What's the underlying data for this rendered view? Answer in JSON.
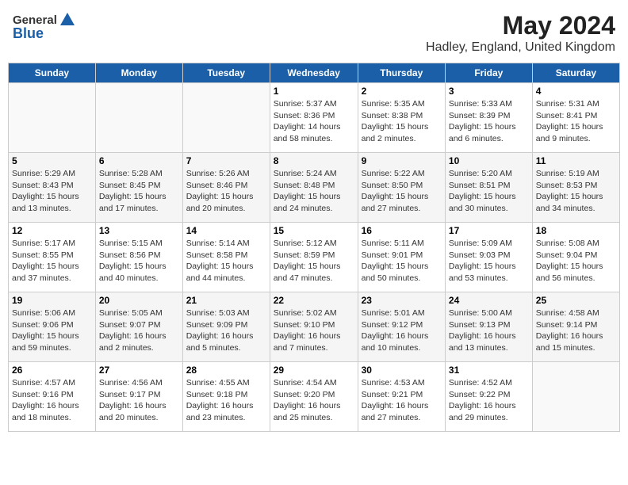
{
  "header": {
    "logo_general": "General",
    "logo_blue": "Blue",
    "month_year": "May 2024",
    "location": "Hadley, England, United Kingdom"
  },
  "weekdays": [
    "Sunday",
    "Monday",
    "Tuesday",
    "Wednesday",
    "Thursday",
    "Friday",
    "Saturday"
  ],
  "weeks": [
    [
      {
        "day": "",
        "info": ""
      },
      {
        "day": "",
        "info": ""
      },
      {
        "day": "",
        "info": ""
      },
      {
        "day": "1",
        "info": "Sunrise: 5:37 AM\nSunset: 8:36 PM\nDaylight: 14 hours\nand 58 minutes."
      },
      {
        "day": "2",
        "info": "Sunrise: 5:35 AM\nSunset: 8:38 PM\nDaylight: 15 hours\nand 2 minutes."
      },
      {
        "day": "3",
        "info": "Sunrise: 5:33 AM\nSunset: 8:39 PM\nDaylight: 15 hours\nand 6 minutes."
      },
      {
        "day": "4",
        "info": "Sunrise: 5:31 AM\nSunset: 8:41 PM\nDaylight: 15 hours\nand 9 minutes."
      }
    ],
    [
      {
        "day": "5",
        "info": "Sunrise: 5:29 AM\nSunset: 8:43 PM\nDaylight: 15 hours\nand 13 minutes."
      },
      {
        "day": "6",
        "info": "Sunrise: 5:28 AM\nSunset: 8:45 PM\nDaylight: 15 hours\nand 17 minutes."
      },
      {
        "day": "7",
        "info": "Sunrise: 5:26 AM\nSunset: 8:46 PM\nDaylight: 15 hours\nand 20 minutes."
      },
      {
        "day": "8",
        "info": "Sunrise: 5:24 AM\nSunset: 8:48 PM\nDaylight: 15 hours\nand 24 minutes."
      },
      {
        "day": "9",
        "info": "Sunrise: 5:22 AM\nSunset: 8:50 PM\nDaylight: 15 hours\nand 27 minutes."
      },
      {
        "day": "10",
        "info": "Sunrise: 5:20 AM\nSunset: 8:51 PM\nDaylight: 15 hours\nand 30 minutes."
      },
      {
        "day": "11",
        "info": "Sunrise: 5:19 AM\nSunset: 8:53 PM\nDaylight: 15 hours\nand 34 minutes."
      }
    ],
    [
      {
        "day": "12",
        "info": "Sunrise: 5:17 AM\nSunset: 8:55 PM\nDaylight: 15 hours\nand 37 minutes."
      },
      {
        "day": "13",
        "info": "Sunrise: 5:15 AM\nSunset: 8:56 PM\nDaylight: 15 hours\nand 40 minutes."
      },
      {
        "day": "14",
        "info": "Sunrise: 5:14 AM\nSunset: 8:58 PM\nDaylight: 15 hours\nand 44 minutes."
      },
      {
        "day": "15",
        "info": "Sunrise: 5:12 AM\nSunset: 8:59 PM\nDaylight: 15 hours\nand 47 minutes."
      },
      {
        "day": "16",
        "info": "Sunrise: 5:11 AM\nSunset: 9:01 PM\nDaylight: 15 hours\nand 50 minutes."
      },
      {
        "day": "17",
        "info": "Sunrise: 5:09 AM\nSunset: 9:03 PM\nDaylight: 15 hours\nand 53 minutes."
      },
      {
        "day": "18",
        "info": "Sunrise: 5:08 AM\nSunset: 9:04 PM\nDaylight: 15 hours\nand 56 minutes."
      }
    ],
    [
      {
        "day": "19",
        "info": "Sunrise: 5:06 AM\nSunset: 9:06 PM\nDaylight: 15 hours\nand 59 minutes."
      },
      {
        "day": "20",
        "info": "Sunrise: 5:05 AM\nSunset: 9:07 PM\nDaylight: 16 hours\nand 2 minutes."
      },
      {
        "day": "21",
        "info": "Sunrise: 5:03 AM\nSunset: 9:09 PM\nDaylight: 16 hours\nand 5 minutes."
      },
      {
        "day": "22",
        "info": "Sunrise: 5:02 AM\nSunset: 9:10 PM\nDaylight: 16 hours\nand 7 minutes."
      },
      {
        "day": "23",
        "info": "Sunrise: 5:01 AM\nSunset: 9:12 PM\nDaylight: 16 hours\nand 10 minutes."
      },
      {
        "day": "24",
        "info": "Sunrise: 5:00 AM\nSunset: 9:13 PM\nDaylight: 16 hours\nand 13 minutes."
      },
      {
        "day": "25",
        "info": "Sunrise: 4:58 AM\nSunset: 9:14 PM\nDaylight: 16 hours\nand 15 minutes."
      }
    ],
    [
      {
        "day": "26",
        "info": "Sunrise: 4:57 AM\nSunset: 9:16 PM\nDaylight: 16 hours\nand 18 minutes."
      },
      {
        "day": "27",
        "info": "Sunrise: 4:56 AM\nSunset: 9:17 PM\nDaylight: 16 hours\nand 20 minutes."
      },
      {
        "day": "28",
        "info": "Sunrise: 4:55 AM\nSunset: 9:18 PM\nDaylight: 16 hours\nand 23 minutes."
      },
      {
        "day": "29",
        "info": "Sunrise: 4:54 AM\nSunset: 9:20 PM\nDaylight: 16 hours\nand 25 minutes."
      },
      {
        "day": "30",
        "info": "Sunrise: 4:53 AM\nSunset: 9:21 PM\nDaylight: 16 hours\nand 27 minutes."
      },
      {
        "day": "31",
        "info": "Sunrise: 4:52 AM\nSunset: 9:22 PM\nDaylight: 16 hours\nand 29 minutes."
      },
      {
        "day": "",
        "info": ""
      }
    ]
  ]
}
